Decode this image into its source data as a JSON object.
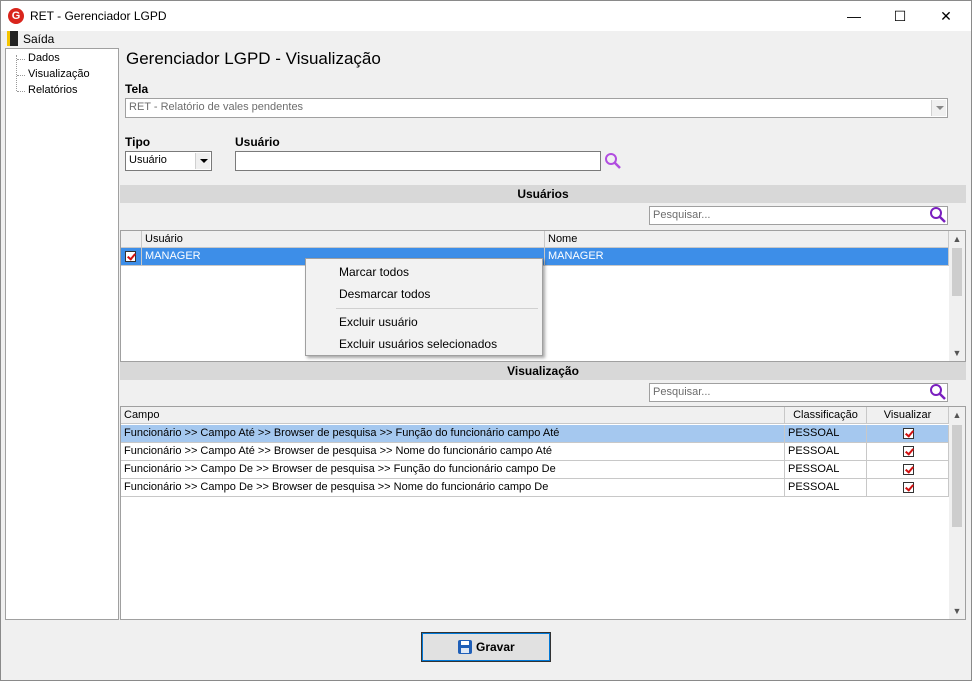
{
  "window": {
    "title": "RET - Gerenciador LGPD",
    "app_icon_letter": "G",
    "minimize_glyph": "—",
    "maximize_glyph": "☐",
    "close_glyph": "✕"
  },
  "menu": {
    "exit_label": "Saída"
  },
  "tree": {
    "items": [
      "Dados",
      "Visualização",
      "Relatórios"
    ]
  },
  "page": {
    "title": "Gerenciador LGPD - Visualização"
  },
  "tela": {
    "label": "Tela",
    "value": "RET - Relatório de vales pendentes"
  },
  "tipo": {
    "label": "Tipo",
    "value": "Usuário"
  },
  "usuario": {
    "label": "Usuário",
    "value": ""
  },
  "usuarios_section": {
    "title": "Usuários",
    "search_placeholder": "Pesquisar...",
    "columns": [
      "Usuário",
      "Nome"
    ],
    "rows": [
      {
        "checked": true,
        "usuario": "MANAGER",
        "nome": "MANAGER"
      }
    ]
  },
  "context_menu": {
    "items": [
      "Marcar todos",
      "Desmarcar todos",
      "Excluir usuário",
      "Excluir usuários selecionados"
    ]
  },
  "visualizacao_section": {
    "title": "Visualização",
    "search_placeholder": "Pesquisar...",
    "columns": [
      "Campo",
      "Classificação",
      "Visualizar"
    ],
    "rows": [
      {
        "campo": "Funcionário >> Campo Até >> Browser de pesquisa >> Função do funcionário campo Até",
        "classificacao": "PESSOAL",
        "visualizar": true
      },
      {
        "campo": "Funcionário >> Campo Até >> Browser de pesquisa >> Nome do funcionário campo Até",
        "classificacao": "PESSOAL",
        "visualizar": true
      },
      {
        "campo": "Funcionário >> Campo De >> Browser de pesquisa >> Função do funcionário campo De",
        "classificacao": "PESSOAL",
        "visualizar": true
      },
      {
        "campo": "Funcionário >> Campo De >> Browser de pesquisa >> Nome do funcionário campo De",
        "classificacao": "PESSOAL",
        "visualizar": true
      }
    ]
  },
  "actions": {
    "save_label": "Gravar"
  },
  "colors": {
    "selection": "#3d8ee8",
    "selection_light": "#a5c8ef",
    "section_bar": "#d8d8d8",
    "search_icon": "#8b2fc9",
    "check_mark": "#d01010"
  }
}
